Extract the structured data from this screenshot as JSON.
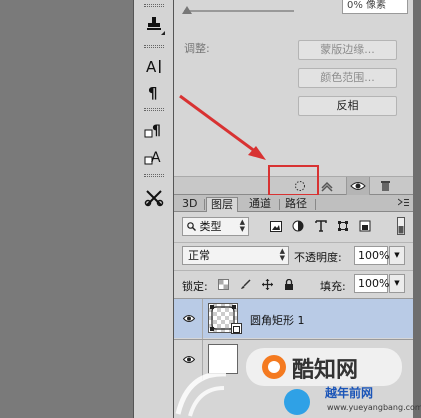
{
  "properties": {
    "slider_value": "0% 像素",
    "adjust_label": "调整:",
    "buttons": [
      {
        "label": "蒙版边缘...",
        "active": false
      },
      {
        "label": "颜色范围...",
        "active": false
      },
      {
        "label": "反相",
        "active": true
      }
    ]
  },
  "tools": [
    {
      "name": "stamp-tool-icon",
      "glyph": "⛁"
    },
    {
      "name": "type-tool-icon",
      "glyph": "A|"
    },
    {
      "name": "paragraph-icon",
      "glyph": "¶"
    },
    {
      "name": "char-style-icon",
      "glyph": "¶"
    },
    {
      "name": "paragraph-style-icon",
      "glyph": "A"
    },
    {
      "name": "tool-presets-icon",
      "glyph": "✂"
    }
  ],
  "panel_tabs": [
    {
      "label": "3D",
      "active": false
    },
    {
      "label": "图层",
      "active": true
    },
    {
      "label": "通道",
      "active": false
    },
    {
      "label": "路径",
      "active": false
    }
  ],
  "layers_panel": {
    "filter_kind": "类型",
    "blend_mode": "正常",
    "opacity_label": "不透明度:",
    "opacity_value": "100%",
    "lock_label": "锁定:",
    "fill_label": "填充:",
    "fill_value": "100%",
    "layers": [
      {
        "name": "圆角矩形 1",
        "selected": true,
        "visible": true
      },
      {
        "name": "",
        "selected": false,
        "visible": true
      }
    ]
  },
  "watermark": {
    "brand": "酷知网",
    "site_name": "越年前网",
    "site_url": "www.yueyangbang.com"
  },
  "colors": {
    "annotation_red": "#d83232",
    "selected_layer": "#b9cbe6",
    "brand_blue": "#1b55b8"
  }
}
